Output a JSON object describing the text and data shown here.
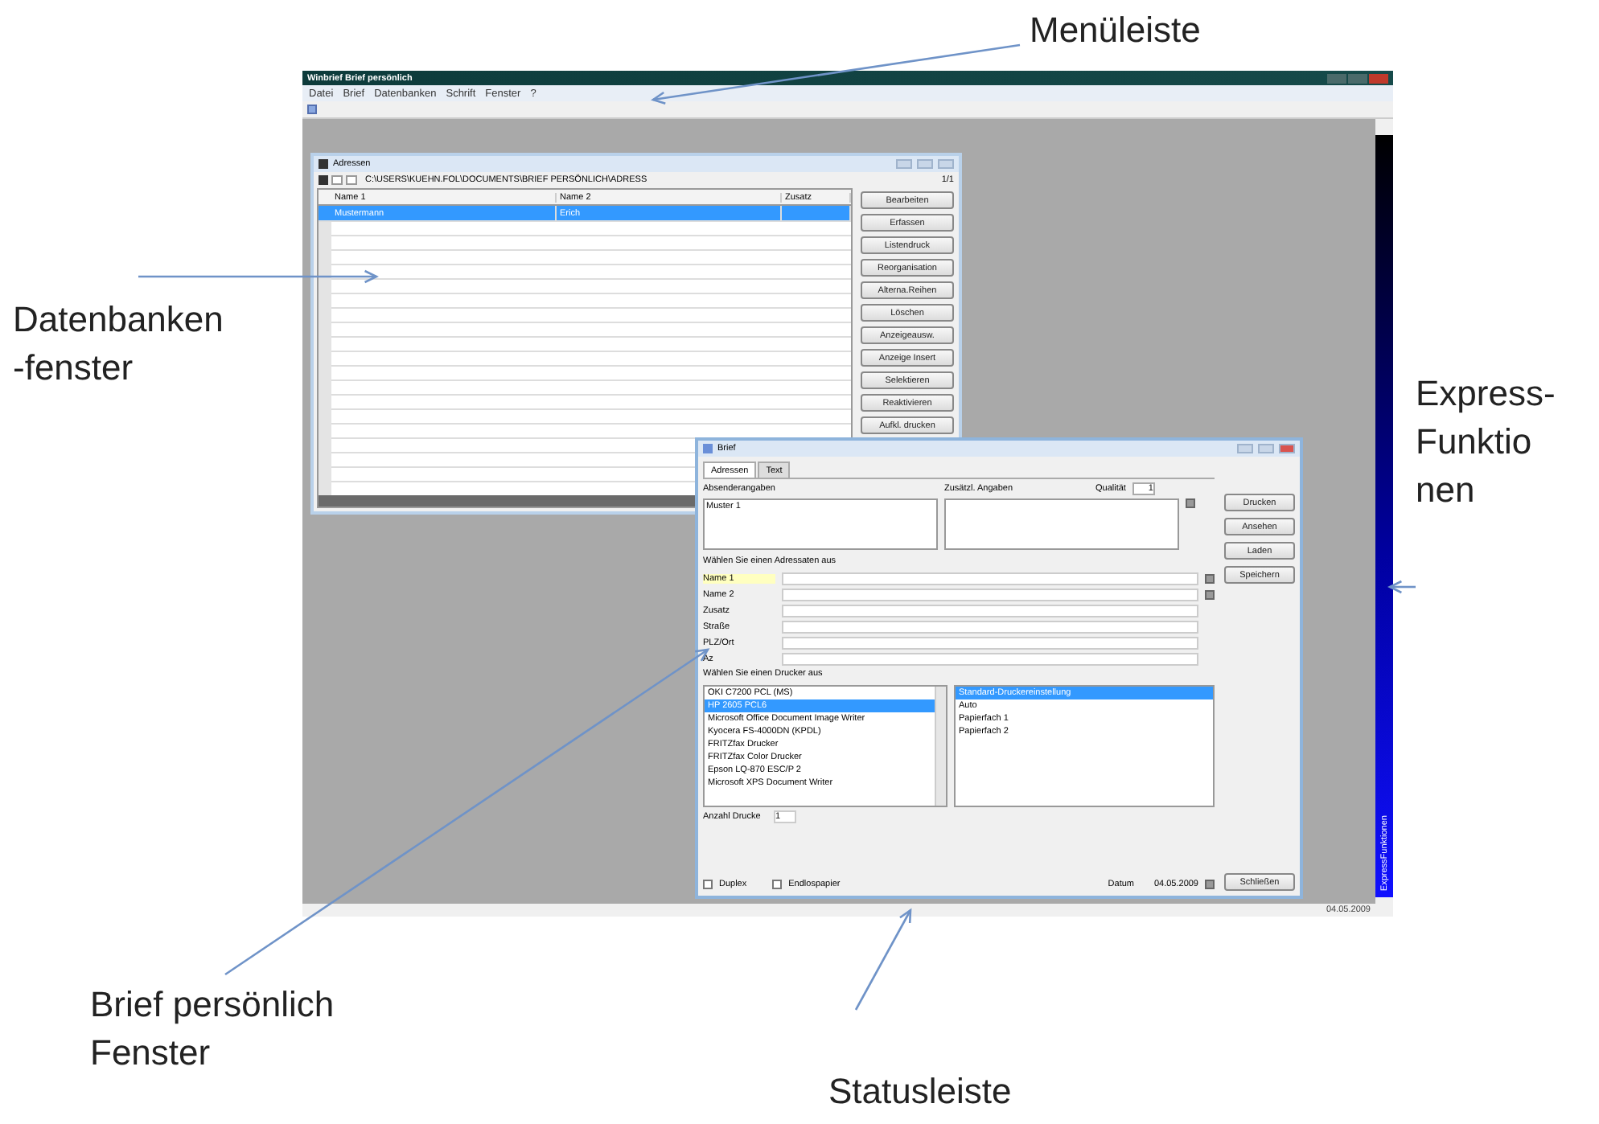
{
  "callouts": [
    {
      "lines": [
        "Menüleiste"
      ]
    },
    {
      "lines": [
        "Datenbanken",
        "-fenster"
      ]
    },
    {
      "lines": [
        "Express-",
        "Funktio",
        "nen"
      ]
    },
    {
      "lines": [
        "Brief persönlich",
        "Fenster"
      ]
    },
    {
      "lines": [
        "Statusleiste"
      ]
    }
  ],
  "app": {
    "title": "Winbrief Brief persönlich",
    "menu": [
      "Datei",
      "Brief",
      "Datenbanken",
      "Schrift",
      "Fenster",
      "?"
    ],
    "address_window": {
      "title": "Adressen",
      "path": "C:\\USERS\\KUEHN.FOL\\DOCUMENTS\\BRIEF PERSÖNLICH\\ADRESS",
      "record": "1/1",
      "columns": [
        "Name 1",
        "Name 2",
        "Zusatz"
      ],
      "rows": [
        {
          "cells": [
            "Mustermann",
            "Erich",
            ""
          ],
          "selected": true
        }
      ],
      "buttons": [
        "Bearbeiten",
        "Erfassen",
        "Listendruck",
        "Reorganisation",
        "Alterna.Reihen",
        "Löschen",
        "Anzeigeausw.",
        "Anzeige Insert",
        "Selektieren",
        "Reaktivieren",
        "Aufkl. drucken"
      ]
    },
    "letter_window": {
      "title": "Brief",
      "tabs": [
        {
          "label": "Adressen",
          "selected": true
        },
        {
          "label": "Text",
          "selected": false
        }
      ],
      "sender_label": "Absenderangaben",
      "extra_label": "Zusätzl. Angaben",
      "quality_label": "Qualität",
      "quality_value": "1",
      "sender_value": "Muster 1",
      "recipient_heading": "Wählen Sie einen Adressaten aus",
      "fields": [
        {
          "label": "Name 1",
          "focused": true
        },
        {
          "label": "Name 2",
          "focused": false
        },
        {
          "label": "Zusatz",
          "focused": false
        },
        {
          "label": "Straße",
          "focused": false
        },
        {
          "label": "PLZ/Ort",
          "focused": false
        },
        {
          "label": "Az",
          "focused": false
        }
      ],
      "printer_heading": "Wählen Sie einen Drucker aus",
      "printers": [
        {
          "name": "OKI C7200 PCL (MS)",
          "selected": false
        },
        {
          "name": "HP 2605 PCL6",
          "selected": true
        },
        {
          "name": "Microsoft Office Document Image Writer",
          "selected": false
        },
        {
          "name": "Kyocera FS-4000DN (KPDL)",
          "selected": false
        },
        {
          "name": "FRITZfax Drucker",
          "selected": false
        },
        {
          "name": "FRITZfax Color Drucker",
          "selected": false
        },
        {
          "name": "Epson LQ-870 ESC/P 2",
          "selected": false
        },
        {
          "name": "Microsoft XPS Document Writer",
          "selected": false
        }
      ],
      "trays": [
        {
          "name": "Standard-Druckereinstellung",
          "selected": true
        },
        {
          "name": "Auto",
          "selected": false
        },
        {
          "name": "Papierfach 1",
          "selected": false
        },
        {
          "name": "Papierfach 2",
          "selected": false
        }
      ],
      "copies_label": "Anzahl Drucke",
      "copies_value": "1",
      "checkboxes": [
        {
          "label": "Duplex",
          "checked": false
        },
        {
          "label": "Endlospapier",
          "checked": false
        }
      ],
      "date_label": "Datum",
      "date_value": "04.05.2009",
      "buttons": [
        "Drucken",
        "Ansehen",
        "Laden",
        "Speichern"
      ],
      "close_button": "Schließen"
    },
    "express_label": "ExpressFunktionen",
    "status_date": "04.05.2009"
  }
}
